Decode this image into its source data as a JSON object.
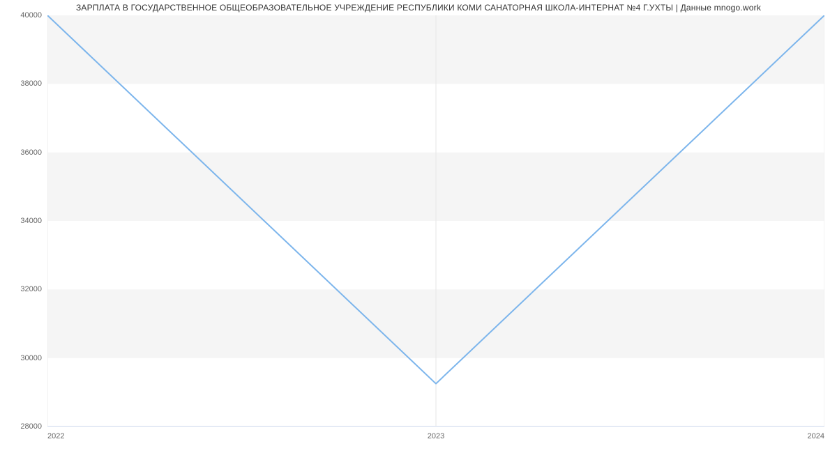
{
  "chart_data": {
    "type": "line",
    "title": "ЗАРПЛАТА В ГОСУДАРСТВЕННОЕ ОБЩЕОБРАЗОВАТЕЛЬНОЕ УЧРЕЖДЕНИЕ РЕСПУБЛИКИ КОМИ САНАТОРНАЯ ШКОЛА-ИНТЕРНАТ №4 Г.УХТЫ | Данные mnogo.work",
    "x": [
      "2022",
      "2023",
      "2024"
    ],
    "values": [
      40000,
      29250,
      40000
    ],
    "xlabel": "",
    "ylabel": "",
    "ylim": [
      28000,
      40000
    ],
    "y_ticks": [
      28000,
      30000,
      32000,
      34000,
      36000,
      38000,
      40000
    ],
    "y_tick_labels": [
      "28000",
      "30000",
      "32000",
      "34000",
      "36000",
      "38000",
      "40000"
    ],
    "x_tick_labels": [
      "2022",
      "2023",
      "2024"
    ],
    "line_color": "#7cb5ec",
    "grid_band_color": "#f5f5f5",
    "axis_color": "#ccd6eb"
  }
}
